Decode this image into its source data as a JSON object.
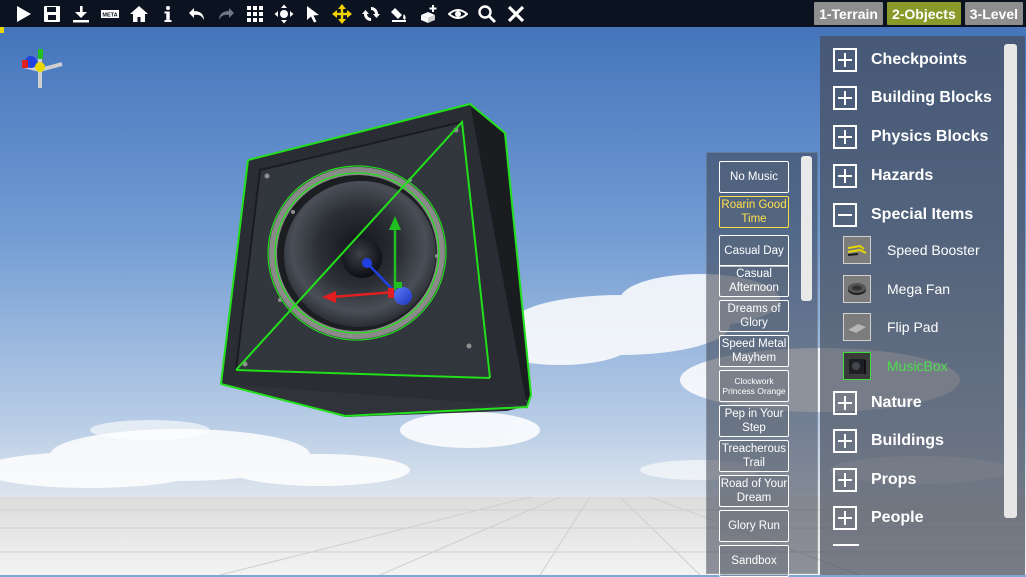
{
  "toolbar": {
    "icons": [
      "play-icon",
      "save-icon",
      "download-icon",
      "meta-icon",
      "home-icon",
      "info-icon",
      "undo-icon",
      "redo-icon",
      "grid-icon",
      "orbit-icon",
      "select-arrow-icon",
      "move-icon",
      "rotate-icon",
      "paint-icon",
      "add-object-icon",
      "eye-icon",
      "search-icon",
      "close-icon"
    ],
    "meta_label": "META",
    "accent_color": "#e8d800"
  },
  "mode_tabs": [
    {
      "label": "1-Terrain",
      "active": false
    },
    {
      "label": "2-Objects",
      "active": true
    },
    {
      "label": "3-Level",
      "active": false
    }
  ],
  "music": {
    "items": [
      {
        "label": "No Music",
        "selected": false
      },
      {
        "label": "Roarin Good Time",
        "selected": true
      },
      {
        "label": "Casual Day",
        "selected": false
      },
      {
        "label": "Casual Afternoon",
        "selected": false
      },
      {
        "label": "Dreams of Glory",
        "selected": false
      },
      {
        "label": "Speed Metal Mayhem",
        "selected": false
      },
      {
        "label": "Clockwork Princess Orange",
        "selected": false,
        "small": true
      },
      {
        "label": "Pep in Your Step",
        "selected": false
      },
      {
        "label": "Treacherous Trail",
        "selected": false
      },
      {
        "label": "Road of Your Dream",
        "selected": false
      },
      {
        "label": "Glory Run",
        "selected": false
      },
      {
        "label": "Sandbox",
        "selected": false
      }
    ],
    "selected_color": "#ffe04a"
  },
  "catalog": {
    "categories": [
      {
        "label": "Checkpoints",
        "expanded": false
      },
      {
        "label": "Building Blocks",
        "expanded": false
      },
      {
        "label": "Physics Blocks",
        "expanded": false
      },
      {
        "label": "Hazards",
        "expanded": false
      },
      {
        "label": "Special Items",
        "expanded": true,
        "children": [
          {
            "label": "Speed Booster",
            "icon": "speed-booster-icon",
            "active": false
          },
          {
            "label": "Mega Fan",
            "icon": "mega-fan-icon",
            "active": false
          },
          {
            "label": "Flip Pad",
            "icon": "flip-pad-icon",
            "active": false
          },
          {
            "label": "MusicBox",
            "icon": "music-box-icon",
            "active": true
          }
        ]
      },
      {
        "label": "Nature",
        "expanded": false
      },
      {
        "label": "Buildings",
        "expanded": false
      },
      {
        "label": "Props",
        "expanded": false
      },
      {
        "label": "People",
        "expanded": false
      }
    ],
    "active_color": "#4be04b"
  },
  "scene": {
    "object": "music-box",
    "selection_color": "#22e01c",
    "gizmo_colors": {
      "x": "#e02020",
      "y": "#20c020",
      "z": "#2040e0"
    }
  }
}
